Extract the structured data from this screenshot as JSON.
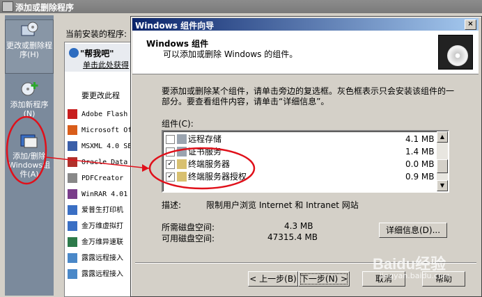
{
  "window": {
    "title": "添加或删除程序"
  },
  "sidebar": {
    "items": [
      {
        "label": "更改或删除程序(H)",
        "icon": "change-remove-icon"
      },
      {
        "label": "添加新程序(N)",
        "icon": "add-program-icon"
      },
      {
        "label": "添加/删除Windows组件(A)",
        "icon": "windows-components-icon"
      }
    ]
  },
  "main": {
    "current_label": "当前安装的程序:",
    "help_title": "\"帮我吧\"",
    "help_link": "单击此处获得",
    "sort_label": "要更改此程",
    "programs": [
      {
        "name": "Adobe Flash",
        "icon": "flash-icon"
      },
      {
        "name": "Microsoft Of",
        "icon": "office-icon"
      },
      {
        "name": "MSXML 4.0 SE",
        "icon": "msxml-icon"
      },
      {
        "name": "Oracle Data",
        "icon": "oracle-icon"
      },
      {
        "name": "PDFCreator",
        "icon": "pdf-icon"
      },
      {
        "name": "WinRAR 4.01",
        "icon": "winrar-icon"
      },
      {
        "name": "爱普生打印机",
        "icon": "printer-icon"
      },
      {
        "name": "金万维虚拟打",
        "icon": "printer-icon"
      },
      {
        "name": "金万维异速联",
        "icon": "network-icon"
      },
      {
        "name": "露露远程接入",
        "icon": "remote-icon"
      },
      {
        "name": "露露远程接入",
        "icon": "remote-icon"
      }
    ]
  },
  "dialog": {
    "title": "Windows 组件向导",
    "close": "×",
    "header_title": "Windows 组件",
    "header_subtitle": "可以添加或删除 Windows 的组件。",
    "body_text": "要添加或删除某个组件，请单击旁边的复选框。灰色框表示只会安装该组件的一部分。要查看组件内容，请单击“详细信息”。",
    "components_label": "组件(C):",
    "components": [
      {
        "name": "远程存储",
        "size": "4.1 MB",
        "checked": false,
        "icon": "storage-icon"
      },
      {
        "name": "证书服务",
        "size": "1.4 MB",
        "checked": false,
        "icon": "certificate-icon"
      },
      {
        "name": "终端服务器",
        "size": "0.0 MB",
        "checked": true,
        "icon": "terminal-server-icon"
      },
      {
        "name": "终端服务器授权",
        "size": "0.9 MB",
        "checked": true,
        "icon": "terminal-license-icon"
      }
    ],
    "desc_label": "描述:",
    "desc_text": "限制用户浏览 Internet 和 Intranet 网站",
    "req_label": "所需磁盘空间:",
    "req_value": "4.3 MB",
    "avail_label": "可用磁盘空间:",
    "avail_value": "47315.4 MB",
    "details_button": "详细信息(D)...",
    "back_button": "< 上一步(B)",
    "next_button": "下一步(N) >",
    "cancel_button": "取消",
    "help_button": "帮助"
  },
  "watermark": {
    "brand": "Baidu经验",
    "url": "jingyan.baidu.com"
  },
  "colors": {
    "titlebar_active": "#0a246a",
    "annotation_red": "#e0101a",
    "sidebar": "#7b8a9c"
  }
}
